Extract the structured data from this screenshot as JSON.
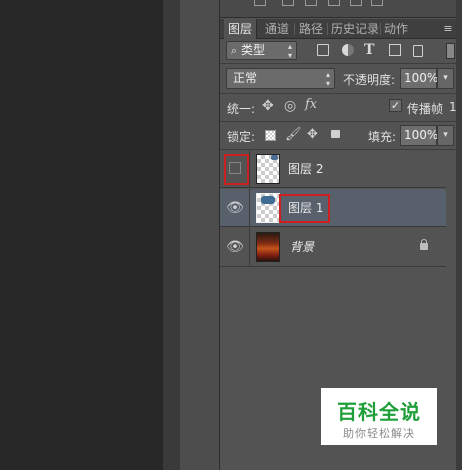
{
  "panel": {
    "tabs": [
      "图层",
      "通道",
      "路径",
      "历史记录",
      "动作"
    ],
    "menu_glyph": "≡"
  },
  "filter": {
    "kind_label": "类型",
    "search_icon": "search-icon"
  },
  "blend": {
    "mode": "正常",
    "opacity_label": "不透明度:",
    "opacity_value": "100%"
  },
  "unify": {
    "label": "统一:",
    "propagate_label": "传播帧",
    "propagate_value": "1",
    "propagate_checked": true
  },
  "lock": {
    "label": "锁定:",
    "fill_label": "填充:",
    "fill_value": "100%"
  },
  "layers": [
    {
      "name": "图层 2",
      "visible": false,
      "thumb": "transparent"
    },
    {
      "name": "图层 1",
      "visible": true,
      "thumb": "transparent-with-content",
      "selected": true
    },
    {
      "name": "背景",
      "visible": true,
      "thumb": "photo",
      "locked": true
    }
  ],
  "watermark": {
    "title": "百科全说",
    "subtitle": "助你轻松解决",
    "color": "#1f9f3a"
  },
  "colors": {
    "panel_bg": "#535353",
    "selected_row": "#58606c",
    "highlight_red": "#cc1f1f"
  }
}
